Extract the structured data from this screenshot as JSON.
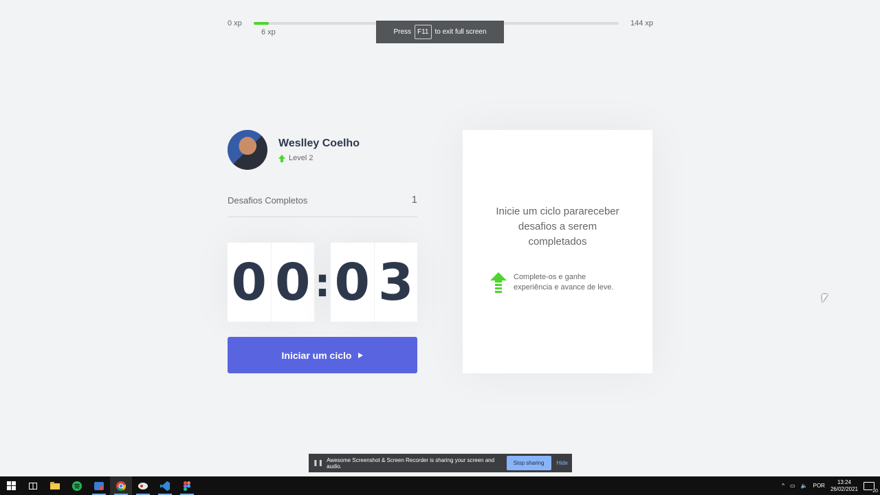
{
  "xp": {
    "min": "0 xp",
    "max": "144 xp",
    "current": "6 xp",
    "progress_fraction": 0.042
  },
  "fullscreen_toast": {
    "prefix": "Press",
    "key": "F11",
    "suffix": "to exit full screen"
  },
  "profile": {
    "name": "Weslley Coelho",
    "level": "Level 2"
  },
  "stats": {
    "completed_label": "Desafios Completos",
    "completed_count": "1"
  },
  "countdown": {
    "minutes": [
      "0",
      "0"
    ],
    "separator": ":",
    "seconds": [
      "0",
      "3"
    ]
  },
  "start_button": {
    "label": "Iniciar um ciclo"
  },
  "challenge_box": {
    "title": "Inicie um ciclo parareceber desafios a serem completados",
    "hint": "Complete-os e ganhe experiência e avance de leve."
  },
  "share_bar": {
    "message": "Awesome Screenshot & Screen Recorder is sharing your screen and audio.",
    "stop_label": "Stop sharing",
    "hide_label": "Hide"
  },
  "taskbar": {
    "icons": [
      "windows-start-icon",
      "task-view-icon",
      "file-explorer-icon",
      "spotify-icon",
      "mail-app-icon",
      "chrome-icon",
      "app-icon",
      "vscode-icon",
      "figma-icon"
    ],
    "language": "POR",
    "time": "13:24",
    "date": "26/02/2021",
    "notifications": "20"
  },
  "colors": {
    "accent": "#5965e0",
    "xp_green": "#4cd62b",
    "title_dark": "#2e384d",
    "background": "#f2f3f5"
  }
}
